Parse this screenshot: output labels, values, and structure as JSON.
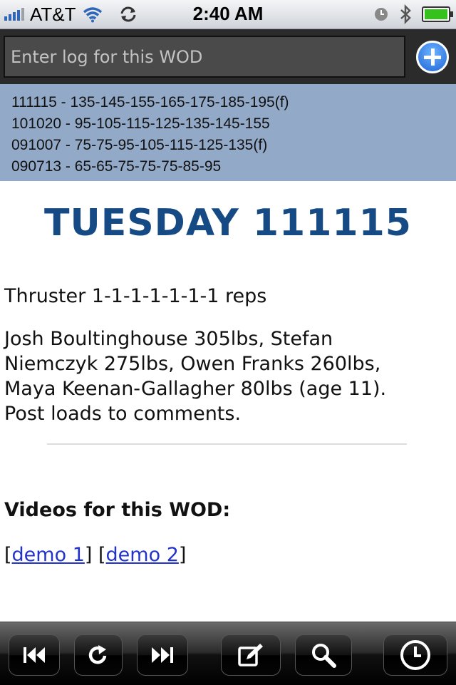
{
  "status_bar": {
    "carrier": "AT&T",
    "time": "2:40 AM"
  },
  "log": {
    "placeholder": "Enter log for this WOD"
  },
  "history": [
    "111115 - 135-145-155-165-175-185-195(f)",
    "101020 - 95-105-115-125-135-145-155",
    "091007 - 75-75-95-105-115-125-135(f)",
    "090713 - 65-65-75-75-75-85-95"
  ],
  "wod": {
    "title": "TUESDAY 111115",
    "line1": "Thruster 1-1-1-1-1-1-1 reps",
    "para": [
      "Josh Boultinghouse 305lbs, Stefan",
      "Niemczyk 275lbs, Owen Franks 260lbs,",
      "Maya Keenan-Gallagher 80lbs (age 11).",
      "Post loads to comments."
    ],
    "videos_heading": "Videos for this WOD:",
    "links": [
      "demo 1",
      "demo 2"
    ]
  },
  "toolbar": {
    "icons": [
      "rewind-icon",
      "refresh-icon",
      "fast-forward-icon",
      "compose-icon",
      "search-icon",
      "clock-icon"
    ]
  },
  "colors": {
    "history_bg": "#93a9c8",
    "title": "#164a84",
    "link": "#2233cc"
  }
}
